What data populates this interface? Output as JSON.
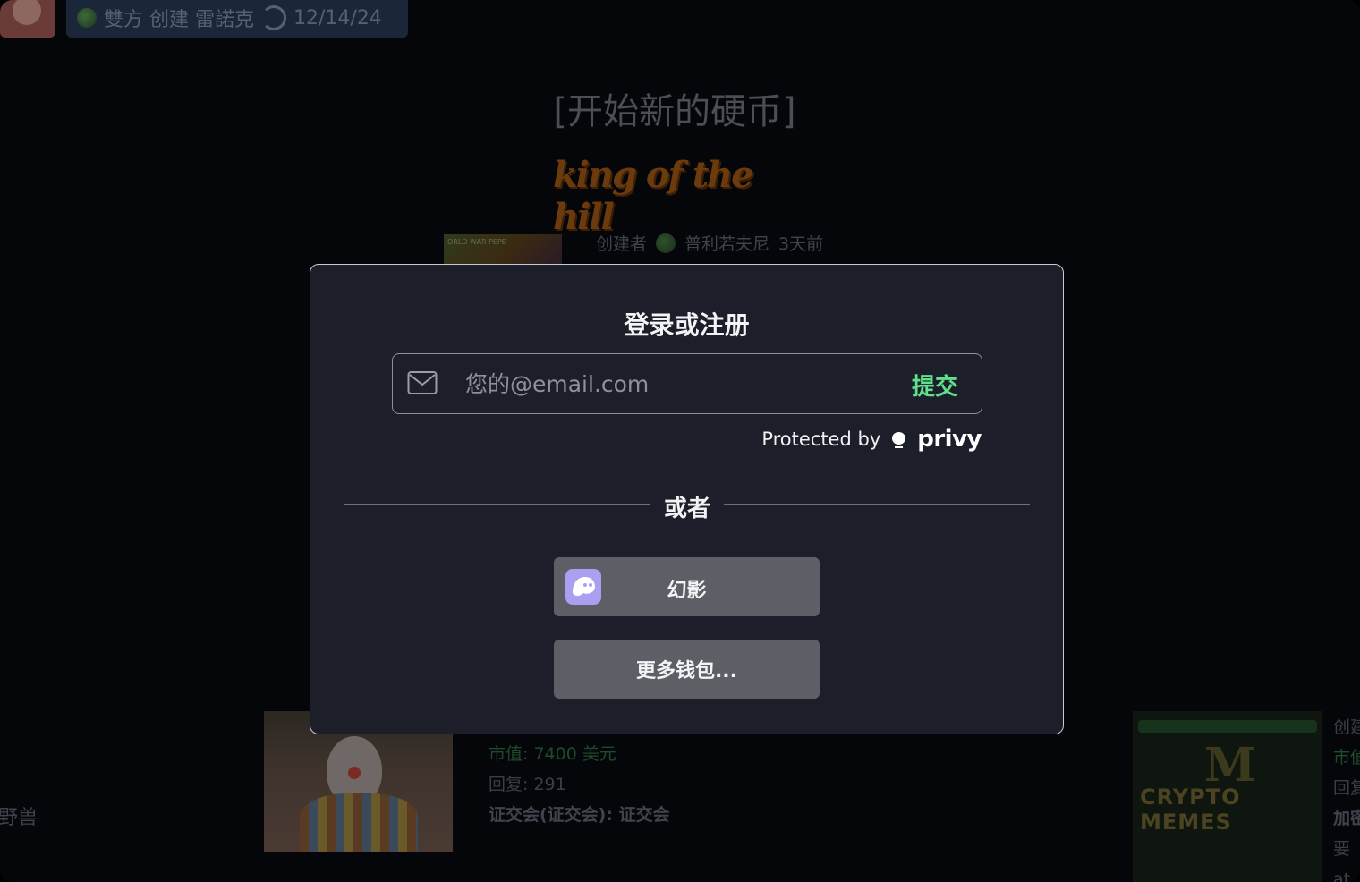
{
  "background": {
    "ticker": {
      "creator_label": "雙方 创建 雷諾克",
      "date": "12/14/24"
    },
    "section_title": "[开始新的硬币]",
    "king_label": "king of the hill",
    "featured": {
      "thumb_text": "ORLD WAR PEPE",
      "creator_prefix": "创建者",
      "creator_name": "普利若夫尼",
      "age": "3天前"
    },
    "card": {
      "market_cap": "市值:  7400 美元",
      "replies": "回复:    291",
      "sec": "证交会(证交会): 证交会"
    },
    "left_clip": "野兽",
    "memes_text": "CRYPTO MEMES",
    "memes_letter": "M",
    "right_clip": [
      "创建",
      "市值",
      "回复",
      "加密",
      "要",
      "at"
    ]
  },
  "modal": {
    "title": "登录或注册",
    "email_placeholder": "您的@email.com",
    "submit_label": "提交",
    "protected_label": "Protected by",
    "privy_label": "privy",
    "divider_label": "或者",
    "phantom_label": "幻影",
    "more_wallets_label": "更多钱包...",
    "colors": {
      "accent": "#5fe08a",
      "phantom": "#ab9ff2",
      "modal_bg": "#1c1e29"
    }
  }
}
